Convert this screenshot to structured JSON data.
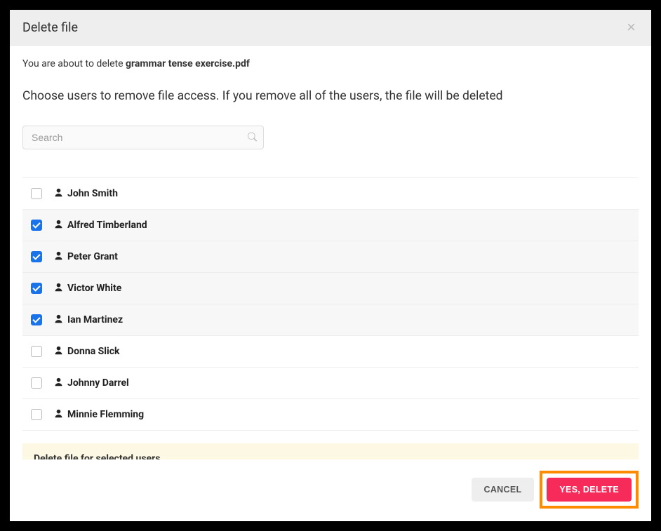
{
  "header": {
    "title": "Delete file"
  },
  "close_icon_glyph": "×",
  "body": {
    "pre_text_prefix": "You are about to delete ",
    "filename": "grammar tense exercise.pdf",
    "instruction": "Choose users to remove file access. If you remove all of the users, the file will be deleted",
    "search_placeholder": "Search"
  },
  "users": [
    {
      "name": "John Smith",
      "checked": false
    },
    {
      "name": "Alfred Timberland",
      "checked": true
    },
    {
      "name": "Peter Grant",
      "checked": true
    },
    {
      "name": "Victor White",
      "checked": true
    },
    {
      "name": "Ian Martinez",
      "checked": true
    },
    {
      "name": "Donna Slick",
      "checked": false
    },
    {
      "name": "Johnny Darrel",
      "checked": false
    },
    {
      "name": "Minnie Flemming",
      "checked": false
    }
  ],
  "summary": {
    "text": "Delete file for selected users"
  },
  "footer": {
    "cancel_label": "Cancel",
    "confirm_label": "Yes, Delete"
  }
}
